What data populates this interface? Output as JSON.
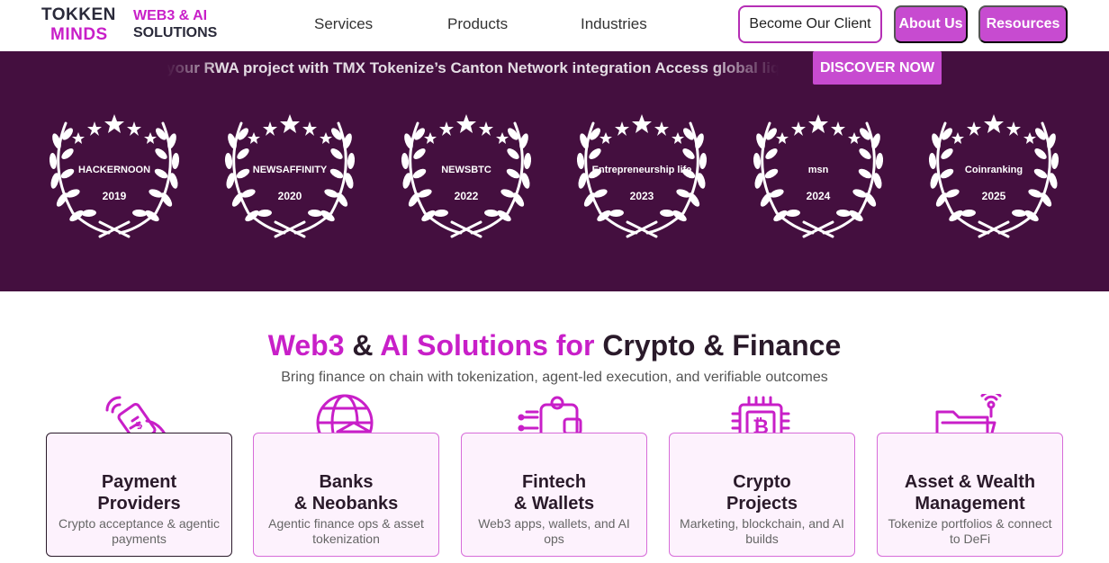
{
  "header": {
    "logo": {
      "line1": "TOKKEN",
      "line2": "MINDS",
      "tag1": "WEB3 & AI",
      "tag2": "SOLUTIONS"
    },
    "nav": [
      {
        "label": "Services"
      },
      {
        "label": "Products"
      },
      {
        "label": "Industries"
      }
    ],
    "become_client": "Become Our Client",
    "about": "About Us",
    "resources": "Resources"
  },
  "banner": {
    "ticker": "your RWA project with TMX Tokenize’s Canton Network integration  Access global liq",
    "cta": "DISCOVER NOW"
  },
  "awards": [
    {
      "brand": "HACKERNOON",
      "year": "2019"
    },
    {
      "brand": "NEWSAFFINITY",
      "year": "2020"
    },
    {
      "brand": "NEWSBTC",
      "year": "2022"
    },
    {
      "brand": "Entrepreneurship life",
      "year": "2023"
    },
    {
      "brand": "msn",
      "year": "2024"
    },
    {
      "brand": "Coinranking",
      "year": "2025"
    }
  ],
  "solutions": {
    "title_part1": "Web3",
    "title_part2": " & ",
    "title_part3": "AI Solutions for",
    "title_part4": " Crypto & Finance",
    "subtitle": "Bring finance on chain with tokenization, agent-led execution, and verifiable outcomes",
    "cards": [
      {
        "title": "Payment\nProviders",
        "desc": "Crypto acceptance & agentic payments",
        "icon": "payment-card-icon"
      },
      {
        "title": "Banks\n& Neobanks",
        "desc": "Agentic finance ops & asset tokenization",
        "icon": "bank-globe-icon"
      },
      {
        "title": "Fintech\n& Wallets",
        "desc": "Web3 apps, wallets, and AI ops",
        "icon": "wallet-circuit-icon"
      },
      {
        "title": "Crypto\nProjects",
        "desc": "Marketing, blockchain, and AI builds",
        "icon": "bitcoin-chip-icon"
      },
      {
        "title": "Asset & Wealth\nManagement",
        "desc": "Tokenize portfolios & connect to DeFi",
        "icon": "folder-gear-icon"
      }
    ]
  },
  "colors": {
    "accent": "#c81fc8",
    "band": "#440f3f",
    "button": "#c74bd0"
  }
}
